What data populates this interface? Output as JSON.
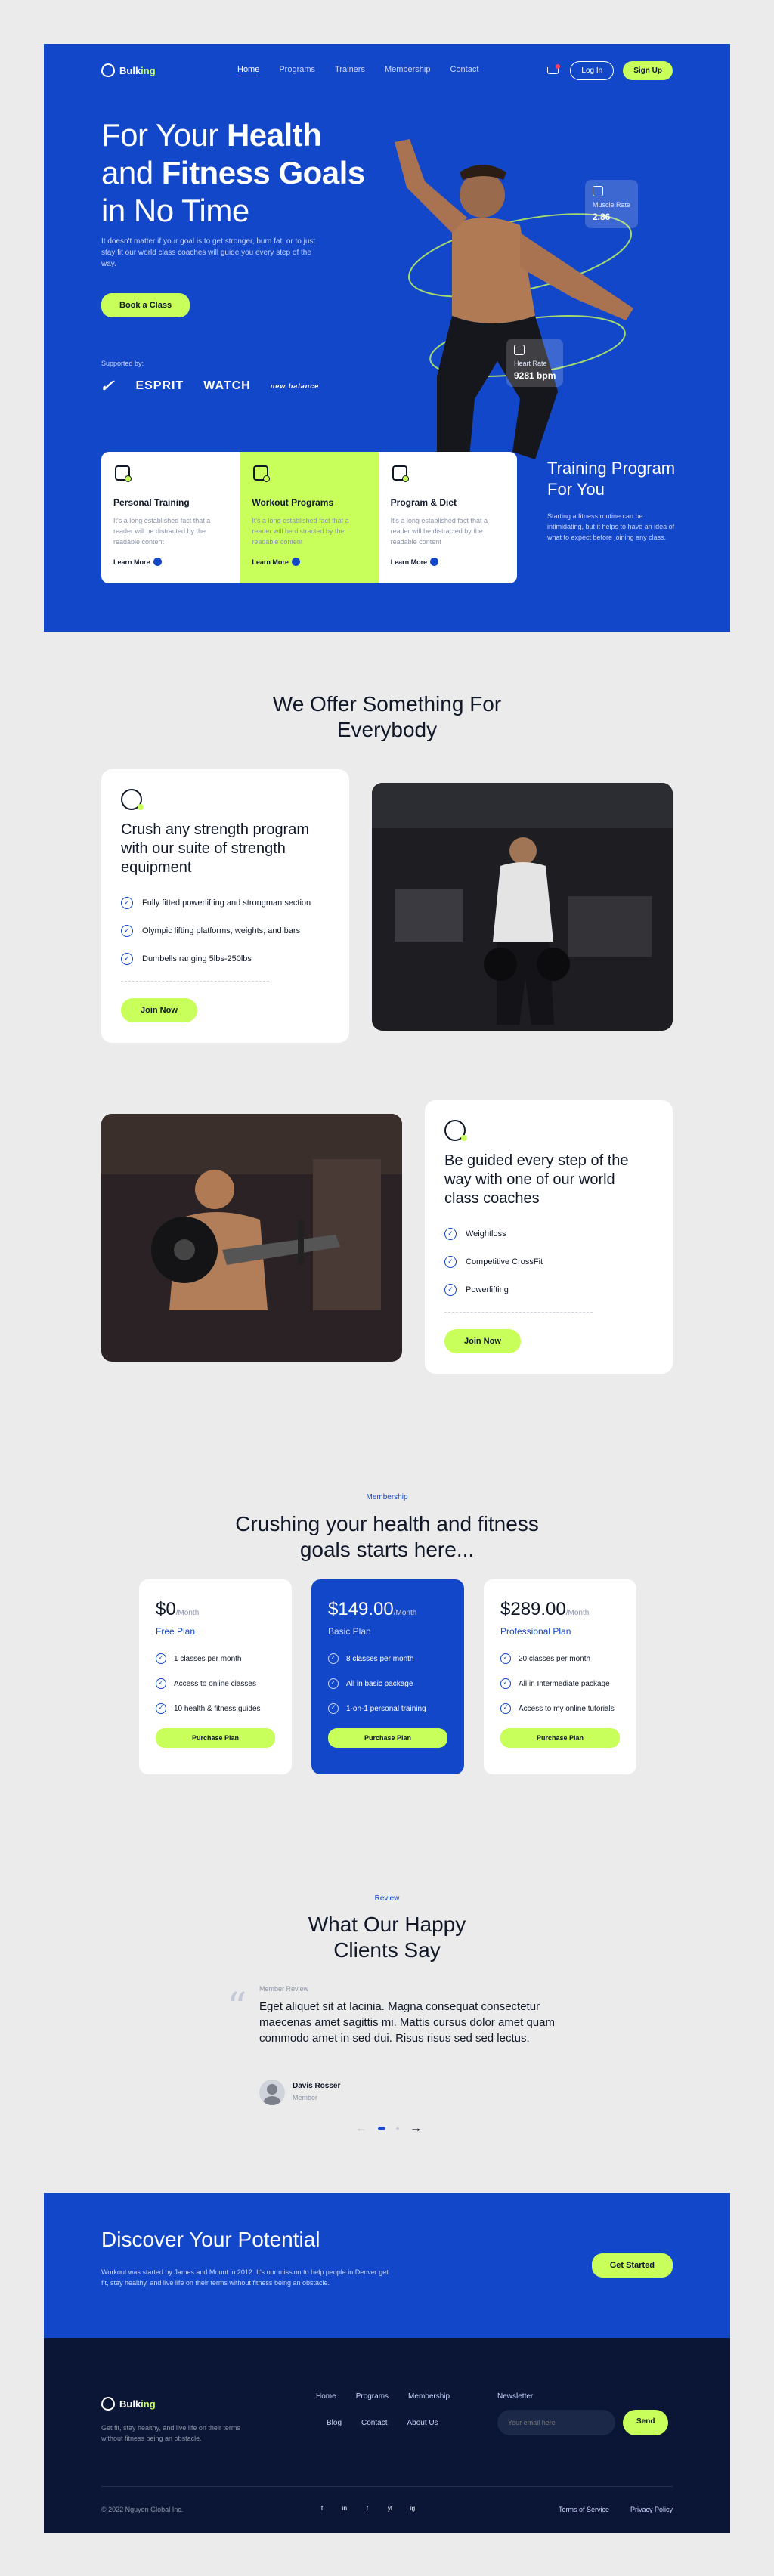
{
  "brand": {
    "name_a": "Bulk",
    "name_b": "ing"
  },
  "nav": {
    "links": [
      "Home",
      "Programs",
      "Trainers",
      "Membership",
      "Contact"
    ],
    "login": "Log In",
    "signup": "Sign Up"
  },
  "hero": {
    "line1_a": "For Your ",
    "line1_b": "Health",
    "line2_a": "and ",
    "line2_b": "Fitness Goals",
    "line3": "in No Time",
    "lead": "It doesn't matter if your goal is to get stronger, burn fat, or to just stay fit our world class coaches will guide you every step of the way.",
    "cta": "Book a Class",
    "supported": "Supported by:",
    "brands": [
      "✓",
      "ESPRIT",
      "WATCH",
      "new balance"
    ],
    "stat_muscle_label": "Muscle Rate",
    "stat_muscle_value": "2.86",
    "stat_heart_label": "Heart Rate",
    "stat_heart_value": "9281 bpm"
  },
  "services": [
    {
      "title": "Personal Training",
      "text": "It's a long established fact that a reader will be distracted by the readable content",
      "link": "Learn More"
    },
    {
      "title": "Workout Programs",
      "text": "It's a long established fact that a reader will be distracted by the readable content",
      "link": "Learn More"
    },
    {
      "title": "Program & Diet",
      "text": "It's a long established fact that a reader will be distracted by the readable content",
      "link": "Learn More"
    }
  ],
  "training": {
    "title": "Training Program For You",
    "text": "Starting a fitness routine can be intimidating, but it helps to have an idea of what to expect before joining any class."
  },
  "offer": {
    "title": "We Offer Something For Everybody",
    "block1": {
      "title": "Crush any strength program with our suite of strength equipment",
      "items": [
        "Fully fitted powerlifting and strongman section",
        "Olympic lifting platforms, weights, and bars",
        "Dumbells ranging 5lbs-250lbs"
      ],
      "cta": "Join Now"
    },
    "block2": {
      "title": "Be guided every step of the way with one of our world class coaches",
      "items": [
        "Weightloss",
        "Competitive CrossFit",
        "Powerlifting"
      ],
      "cta": "Join Now"
    }
  },
  "pricing": {
    "eyebrow": "Membership",
    "title": "Crushing your health and fitness goals starts here...",
    "plans": [
      {
        "price": "$0",
        "per": "/Month",
        "name": "Free Plan",
        "features": [
          "1 classes per month",
          "Access to online classes",
          "10 health & fitness guides"
        ],
        "cta": "Purchase Plan"
      },
      {
        "price": "$149.00",
        "per": "/Month",
        "name": "Basic Plan",
        "features": [
          "8 classes per month",
          "All in basic package",
          "1-on-1 personal training"
        ],
        "cta": "Purchase Plan"
      },
      {
        "price": "$289.00",
        "per": "/Month",
        "name": "Professional Plan",
        "features": [
          "20 classes per month",
          "All in Intermediate package",
          "Access to my online tutorials"
        ],
        "cta": "Purchase Plan"
      }
    ]
  },
  "reviews": {
    "eyebrow": "Review",
    "title": "What Our Happy Clients Say",
    "tag": "Member Review",
    "quote": "Eget aliquet sit at lacinia. Magna consequat consectetur maecenas amet sagittis mi. Mattis cursus dolor amet quam commodo amet in sed dui. Risus risus sed sed lectus.",
    "name": "Davis Rosser",
    "role": "Member",
    "prev": "←",
    "next": "→"
  },
  "cta_band": {
    "title": "Discover Your Potential",
    "text": "Workout was started by James and Mount in 2012. It's our mission to help people in Denver get fit, stay healthy, and live life on their terms without fitness being an obstacle.",
    "button": "Get Started"
  },
  "footer": {
    "tagline": "Get fit, stay healthy, and live life on their terms without fitness being an obstacle.",
    "links_row1": [
      "Home",
      "Programs",
      "Membership"
    ],
    "links_row2": [
      "Blog",
      "Contact",
      "About Us"
    ],
    "newsletter_label": "Newsletter",
    "email_placeholder": "Your email here",
    "send": "Send",
    "copyright": "© 2022 Nguyen Global Inc.",
    "social": [
      "f",
      "in",
      "t",
      "yt",
      "ig"
    ],
    "legal": [
      "Terms of Service",
      "Privacy Policy"
    ]
  },
  "colors": {
    "primary": "#1347c9",
    "accent": "#c8ff5a",
    "dark": "#0b1535"
  }
}
